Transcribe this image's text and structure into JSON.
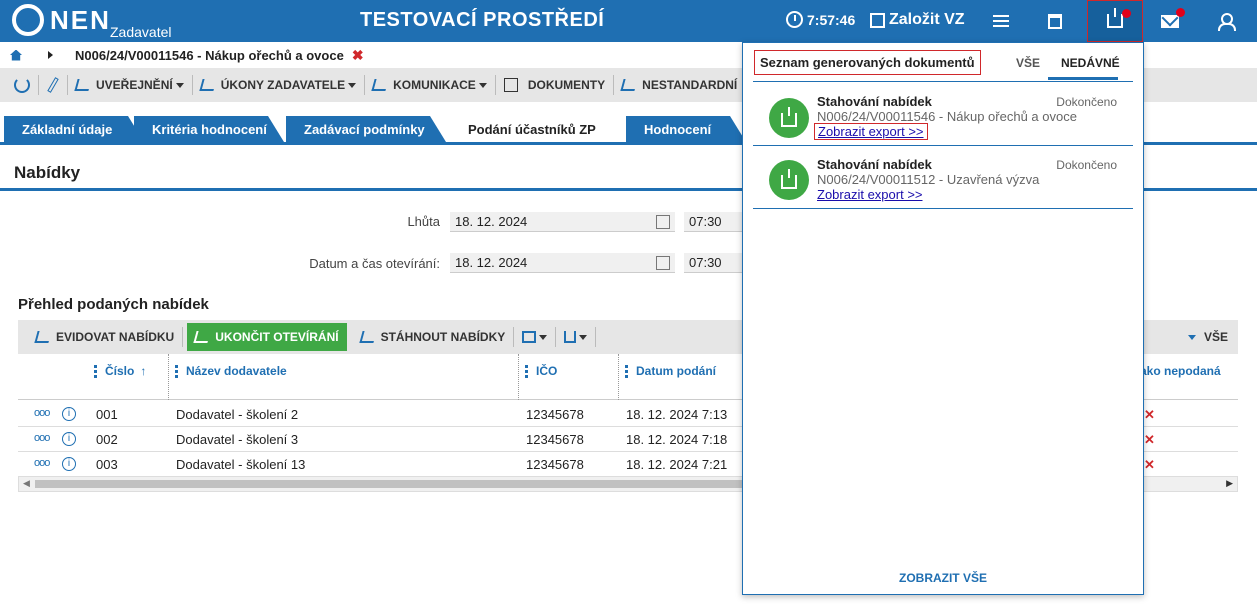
{
  "header": {
    "logo": "NEN",
    "logo_sub": "Zadavatel",
    "env_title": "TESTOVACÍ PROSTŘEDÍ",
    "time": "7:57:46",
    "create_label": "Založit VZ"
  },
  "breadcrumb": {
    "text": "N006/24/V00011546 - Nákup ořechů a ovoce",
    "close": "✖"
  },
  "toolbar": {
    "items": [
      "UVEŘEJNĚNÍ",
      "ÚKONY ZADAVATELE",
      "KOMUNIKACE",
      "DOKUMENTY",
      "NESTANDARDNÍ"
    ]
  },
  "tabs": [
    "Základní údaje",
    "Kritéria hodnocení",
    "Zadávací podmínky",
    "Podání účastníků ZP",
    "Hodnocení"
  ],
  "section_title": "Nabídky",
  "form": {
    "deadline_label": "Lhůta",
    "deadline_date": "18. 12. 2024",
    "deadline_time": "07:30",
    "opening_label": "Datum a čas otevírání:",
    "opening_date": "18. 12. 2024",
    "opening_time": "07:30"
  },
  "grid": {
    "title": "Přehled podaných nabídek",
    "actions": {
      "register": "EVIDOVAT NABÍDKU",
      "finish": "UKONČIT OTEVÍRÁNÍ",
      "download": "STÁHNOUT NABÍDKY",
      "all": "VŠE"
    },
    "columns": [
      "Číslo",
      "Název dodavatele",
      "IČO",
      "Datum podání",
      "ako nepodaná"
    ],
    "rows": [
      {
        "num": "001",
        "name": "Dodavatel - školení 2",
        "ico": "12345678",
        "date": "18. 12. 2024 7:13"
      },
      {
        "num": "002",
        "name": "Dodavatel - školení 3",
        "ico": "12345678",
        "date": "18. 12. 2024 7:18"
      },
      {
        "num": "003",
        "name": "Dodavatel - školení 13",
        "ico": "12345678",
        "date": "18. 12. 2024 7:21"
      }
    ]
  },
  "panel": {
    "title": "Seznam generovaných dokumentů",
    "tab_all": "VŠE",
    "tab_recent": "NEDÁVNÉ",
    "items": [
      {
        "title": "Stahování nabídek",
        "status": "Dokončeno",
        "desc": "N006/24/V00011546 - Nákup ořechů a ovoce",
        "link": "Zobrazit export >>"
      },
      {
        "title": "Stahování nabídek",
        "status": "Dokončeno",
        "desc": "N006/24/V00011512 - Uzavřená výzva",
        "link": "Zobrazit export >>"
      }
    ],
    "show_all": "ZOBRAZIT VŠE"
  },
  "colors": {
    "primary": "#1f6fb2",
    "green": "#3fa845",
    "red": "#d0282b"
  }
}
